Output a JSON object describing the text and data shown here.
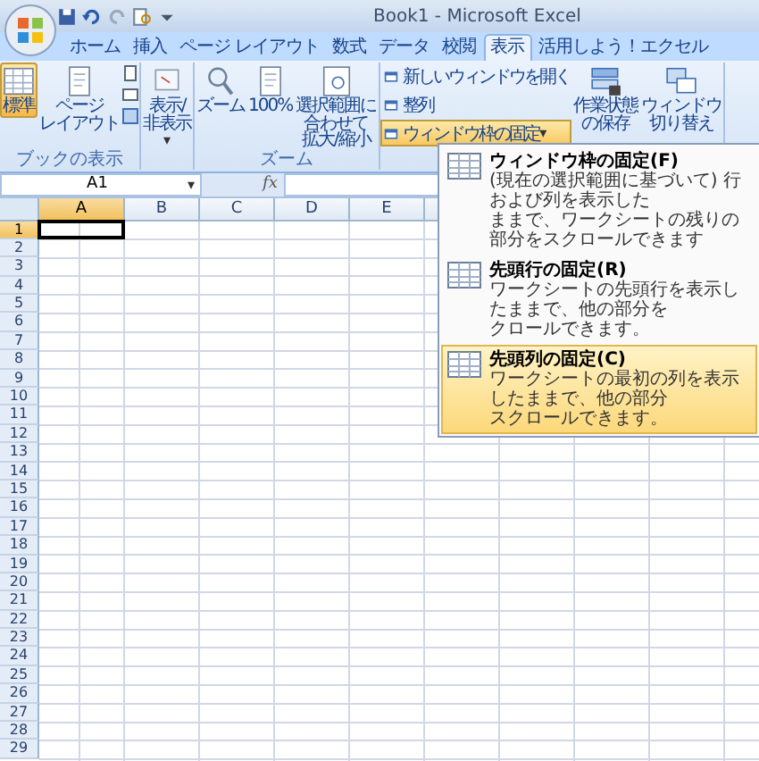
{
  "window": {
    "title": "Book1 - Microsoft Excel"
  },
  "tabs": [
    {
      "label": "ホーム",
      "selected": false
    },
    {
      "label": "挿入",
      "selected": false
    },
    {
      "label": "ページ レイアウト",
      "selected": false
    },
    {
      "label": "数式",
      "selected": false
    },
    {
      "label": "データ",
      "selected": false
    },
    {
      "label": "校閲",
      "selected": false
    },
    {
      "label": "表示",
      "selected": true
    },
    {
      "label": "活用しよう！エクセル",
      "selected": false
    }
  ],
  "ribbon": {
    "groups": [
      {
        "label": "ブックの表示",
        "buttons": [
          {
            "lines": [
              "標準"
            ],
            "selected": true
          },
          {
            "lines": [
              "ページ",
              "レイアウト"
            ],
            "selected": false
          }
        ]
      },
      {
        "buttons": [
          {
            "lines": [
              "表示/",
              "非表示"
            ],
            "selected": false,
            "caret": "▾"
          }
        ]
      },
      {
        "label": "ズーム",
        "buttons": [
          {
            "lines": [
              "ズーム"
            ],
            "selected": false
          },
          {
            "lines": [
              "100%"
            ],
            "selected": false
          },
          {
            "lines": [
              "選択範囲に",
              "合わせて",
              "拡大/縮小"
            ],
            "selected": false
          }
        ]
      },
      {
        "small_buttons": [
          {
            "label": "新しいウィンドウを開く",
            "open": false
          },
          {
            "label": "整列",
            "open": false
          },
          {
            "label": "ウィンドウ枠の固定",
            "open": true,
            "caret": "▾"
          }
        ],
        "buttons": [
          {
            "lines": [
              "作業状態",
              "の保存"
            ],
            "selected": false
          },
          {
            "lines": [
              "ウィンドウ",
              "切り替え"
            ],
            "selected": false
          }
        ]
      }
    ]
  },
  "formula_bar": {
    "name_box": "A1",
    "dropdown": "▾",
    "function_label": "fx"
  },
  "sheet": {
    "columns": [
      {
        "label": "A",
        "selected": true
      },
      {
        "label": "B",
        "selected": false
      },
      {
        "label": "C",
        "selected": false
      },
      {
        "label": "D",
        "selected": false
      },
      {
        "label": "E",
        "selected": false
      }
    ],
    "rows": [
      {
        "label": "1",
        "selected": true
      },
      {
        "label": "2",
        "selected": false
      },
      {
        "label": "3",
        "selected": false
      },
      {
        "label": "4",
        "selected": false
      },
      {
        "label": "5",
        "selected": false
      },
      {
        "label": "6",
        "selected": false
      },
      {
        "label": "7",
        "selected": false
      },
      {
        "label": "8",
        "selected": false
      },
      {
        "label": "9",
        "selected": false
      },
      {
        "label": "10",
        "selected": false
      },
      {
        "label": "11",
        "selected": false
      },
      {
        "label": "12",
        "selected": false
      },
      {
        "label": "13",
        "selected": false
      },
      {
        "label": "14",
        "selected": false
      },
      {
        "label": "15",
        "selected": false
      },
      {
        "label": "16",
        "selected": false
      },
      {
        "label": "17",
        "selected": false
      },
      {
        "label": "18",
        "selected": false
      },
      {
        "label": "19",
        "selected": false
      },
      {
        "label": "20",
        "selected": false
      },
      {
        "label": "21",
        "selected": false
      },
      {
        "label": "22",
        "selected": false
      },
      {
        "label": "23",
        "selected": false
      },
      {
        "label": "24",
        "selected": false
      },
      {
        "label": "25",
        "selected": false
      },
      {
        "label": "26",
        "selected": false
      },
      {
        "label": "27",
        "selected": false
      },
      {
        "label": "28",
        "selected": false
      },
      {
        "label": "29",
        "selected": false
      }
    ]
  },
  "menu": {
    "items": [
      {
        "title": "ウィンドウ枠の固定(F)",
        "lines": [
          "(現在の選択範囲に基づいて) 行および列を表示した",
          "ままで、ワークシートの残りの部分をスクロールできます"
        ],
        "selected": false
      },
      {
        "title": "先頭行の固定(R)",
        "lines": [
          "ワークシートの先頭行を表示したままで、他の部分を",
          "クロールできます。"
        ],
        "selected": false
      },
      {
        "title": "先頭列の固定(C)",
        "lines": [
          "ワークシートの最初の列を表示したままで、他の部分",
          "スクロールできます。"
        ],
        "selected": true
      }
    ]
  }
}
